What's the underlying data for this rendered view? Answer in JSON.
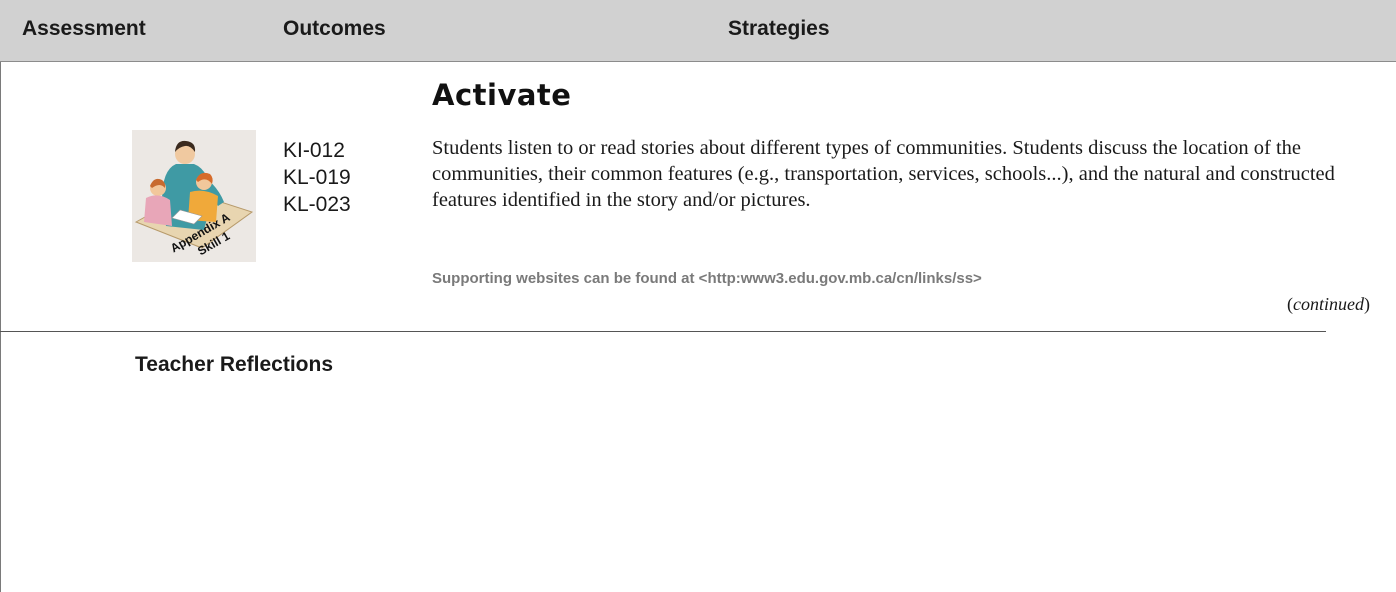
{
  "header": {
    "assessment": "Assessment",
    "outcomes": "Outcomes",
    "strategies": "Strategies"
  },
  "section": {
    "title": "Activate"
  },
  "icon": {
    "name": "appendix-a-skill-1-icon",
    "line1": "Appendix A",
    "line2": "Skill 1"
  },
  "outcomes": [
    "KI-012",
    "KL-019",
    "KL-023"
  ],
  "strategy": {
    "text": "Students listen to or read stories about different types of communities. Students discuss the location of the communities, their common features (e.g., transportation, services, schools...), and the natural and constructed features identified in the story and/or pictures.",
    "websites_note": "Supporting websites can be found at <http:www3.edu.gov.mb.ca/cn/links/ss>",
    "continued_open": "(",
    "continued_word": "continued",
    "continued_close": ")"
  },
  "reflections": {
    "title": "Teacher Reflections"
  },
  "colors": {
    "header_bg": "#d1d1d1",
    "web_note": "#7a7a7a"
  }
}
